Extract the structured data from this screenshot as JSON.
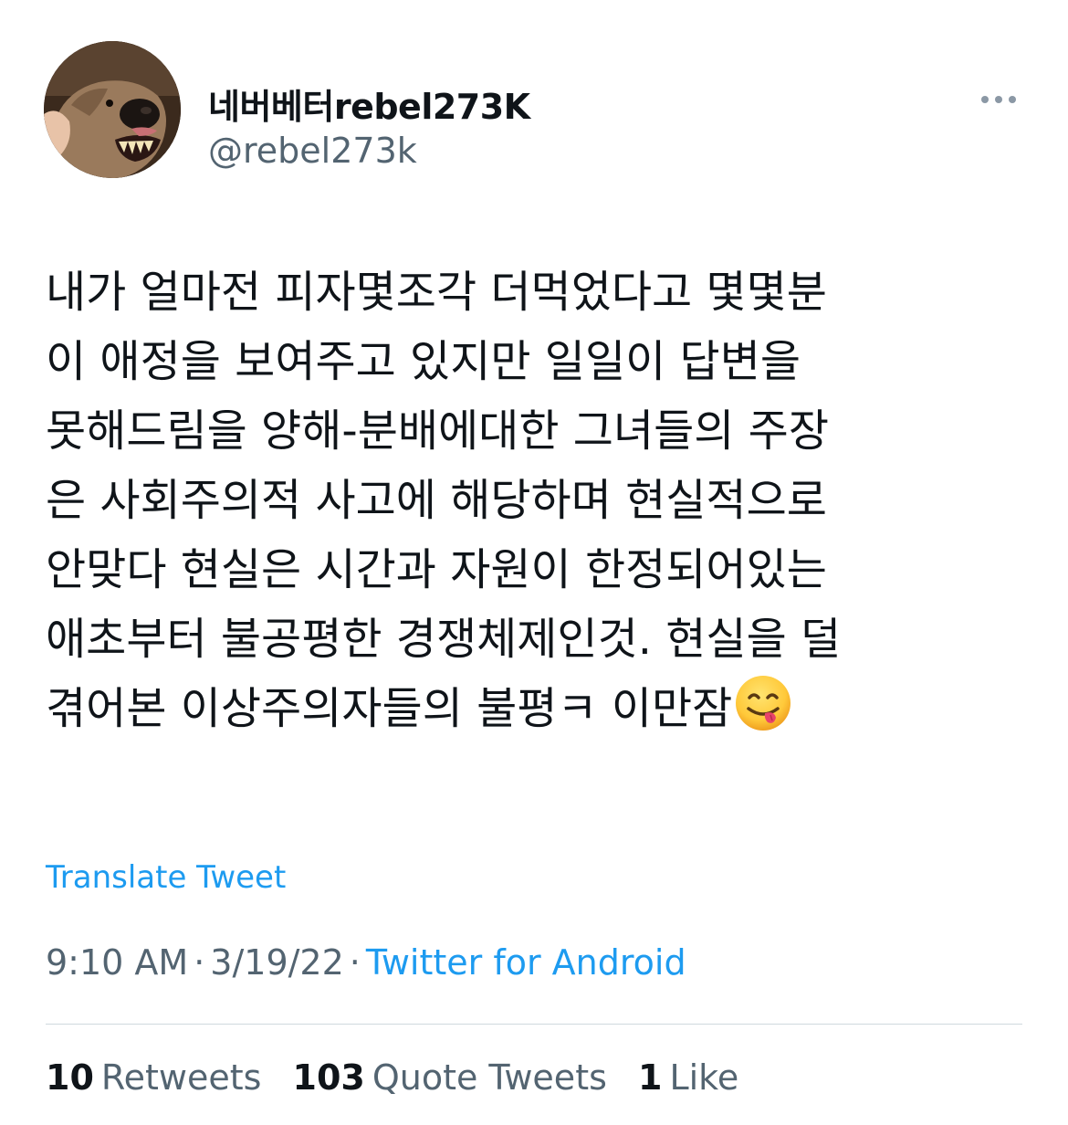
{
  "tweet": {
    "author": {
      "display_name": "네버베터rebel273K",
      "handle": "@rebel273k",
      "avatar_icon": "dog-avatar-icon"
    },
    "more_icon": "more-dots-icon",
    "text_lines": [
      "내가 얼마전 피자몇조각 더먹었다고 몇몇분",
      "이 애정을 보여주고 있지만 일일이 답변을",
      "못해드림을 양해-분배에대한 그녀들의 주장",
      "은 사회주의적 사고에 해당하며 현실적으로",
      "안맞다 현실은 시간과 자원이 한정되어있는",
      "애초부터 불공평한 경쟁체제인것. 현실을 덜",
      "겪어본 이상주의자들의 불평ㅋ 이만잠"
    ],
    "emoji": "face-savoring-food-emoji",
    "translate_label": "Translate Tweet",
    "time": "9:10 AM",
    "date": "3/19/22",
    "separator": "·",
    "source": "Twitter for Android",
    "stats": {
      "retweets_count": "10",
      "retweets_label": "Retweets",
      "quote_tweets_count": "103",
      "quote_tweets_label": "Quote Tweets",
      "likes_count": "1",
      "likes_label": "Like"
    }
  },
  "colors": {
    "text_primary": "#0f1419",
    "text_secondary": "#536471",
    "accent": "#1d9bf0",
    "divider": "#cfd9de"
  }
}
